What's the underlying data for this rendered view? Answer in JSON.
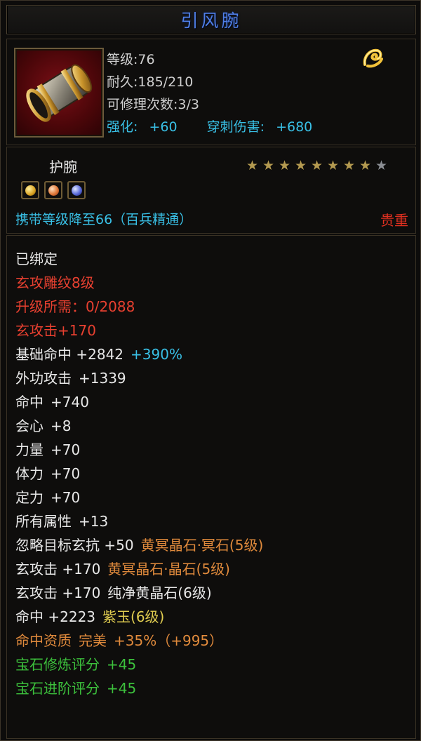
{
  "title": "引风腕",
  "item": {
    "icon": "bracer-icon",
    "level": "等级:76",
    "durability": "耐久:185/210",
    "repairs": "可修理次数:3/3",
    "enhance_label": "强化:",
    "enhance_value": "+60",
    "pierce_label": "穿刺伤害:",
    "pierce_value": "+680"
  },
  "type": "护腕",
  "stars": {
    "filled": 8,
    "total": 9
  },
  "sockets": [
    "gold-gem",
    "orange-gem",
    "blue-gem"
  ],
  "requirement": "携带等级降至66（百兵精通）",
  "rarity": "贵重",
  "properties": [
    {
      "parts": [
        {
          "text": "已绑定",
          "color": "white"
        }
      ]
    },
    {
      "parts": [
        {
          "text": "玄攻雕纹8级",
          "color": "red"
        }
      ]
    },
    {
      "parts": [
        {
          "text": "升级所需：0/2088",
          "color": "red"
        }
      ]
    },
    {
      "parts": [
        {
          "text": "玄攻击+170",
          "color": "red"
        }
      ]
    },
    {
      "parts": [
        {
          "text": "基础命中 +2842",
          "color": "white"
        },
        {
          "text": "+390%",
          "color": "cyan"
        }
      ]
    },
    {
      "parts": [
        {
          "text": "外功攻击",
          "color": "white"
        },
        {
          "text": "+1339",
          "color": "white"
        }
      ]
    },
    {
      "parts": [
        {
          "text": "命中",
          "color": "white"
        },
        {
          "text": "+740",
          "color": "white"
        }
      ]
    },
    {
      "parts": [
        {
          "text": "会心",
          "color": "white"
        },
        {
          "text": "+8",
          "color": "white"
        }
      ]
    },
    {
      "parts": [
        {
          "text": "力量",
          "color": "white"
        },
        {
          "text": "+70",
          "color": "white"
        }
      ]
    },
    {
      "parts": [
        {
          "text": "体力",
          "color": "white"
        },
        {
          "text": "+70",
          "color": "white"
        }
      ]
    },
    {
      "parts": [
        {
          "text": "定力",
          "color": "white"
        },
        {
          "text": "+70",
          "color": "white"
        }
      ]
    },
    {
      "parts": [
        {
          "text": "所有属性",
          "color": "white"
        },
        {
          "text": "+13",
          "color": "white"
        }
      ]
    },
    {
      "parts": [
        {
          "text": "忽略目标玄抗 +50",
          "color": "white"
        },
        {
          "text": "黄冥晶石·冥石(5级)",
          "color": "orange"
        }
      ]
    },
    {
      "parts": [
        {
          "text": "玄攻击 +170",
          "color": "white"
        },
        {
          "text": "黄冥晶石·晶石(5级)",
          "color": "orange"
        }
      ]
    },
    {
      "parts": [
        {
          "text": "玄攻击 +170",
          "color": "white"
        },
        {
          "text": "纯净黄晶石(6级)",
          "color": "white"
        }
      ]
    },
    {
      "parts": [
        {
          "text": "命中 +2223",
          "color": "white"
        },
        {
          "text": "紫玉(6级)",
          "color": "yellow"
        }
      ]
    },
    {
      "parts": [
        {
          "text": "命中资质",
          "color": "orange"
        },
        {
          "text": "完美",
          "color": "orange"
        },
        {
          "text": "+35%（+995）",
          "color": "orange"
        }
      ]
    },
    {
      "parts": [
        {
          "text": "宝石修炼评分",
          "color": "green"
        },
        {
          "text": "+45",
          "color": "green"
        }
      ]
    },
    {
      "parts": [
        {
          "text": "宝石进阶评分",
          "color": "green"
        },
        {
          "text": "+45",
          "color": "green"
        }
      ]
    }
  ]
}
